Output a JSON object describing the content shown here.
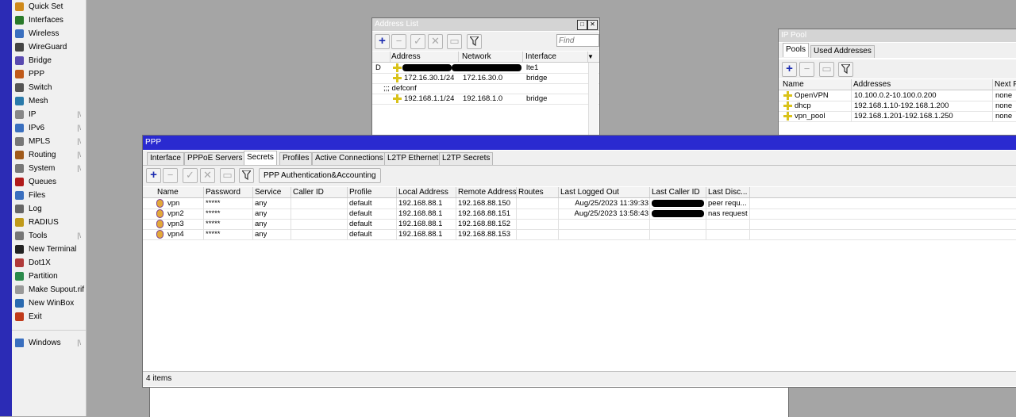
{
  "menu": {
    "items": [
      {
        "label": "Quick Set",
        "icon": "quick-set-icon",
        "arrow": false
      },
      {
        "label": "Interfaces",
        "icon": "interfaces-icon",
        "arrow": false
      },
      {
        "label": "Wireless",
        "icon": "wireless-icon",
        "arrow": false
      },
      {
        "label": "WireGuard",
        "icon": "wireguard-icon",
        "arrow": false
      },
      {
        "label": "Bridge",
        "icon": "bridge-icon",
        "arrow": false
      },
      {
        "label": "PPP",
        "icon": "ppp-icon",
        "arrow": false
      },
      {
        "label": "Switch",
        "icon": "switch-icon",
        "arrow": false
      },
      {
        "label": "Mesh",
        "icon": "mesh-icon",
        "arrow": false
      },
      {
        "label": "IP",
        "icon": "ip-icon",
        "arrow": true
      },
      {
        "label": "IPv6",
        "icon": "ipv6-icon",
        "arrow": true
      },
      {
        "label": "MPLS",
        "icon": "mpls-icon",
        "arrow": true
      },
      {
        "label": "Routing",
        "icon": "routing-icon",
        "arrow": true
      },
      {
        "label": "System",
        "icon": "system-icon",
        "arrow": true
      },
      {
        "label": "Queues",
        "icon": "queues-icon",
        "arrow": false
      },
      {
        "label": "Files",
        "icon": "files-icon",
        "arrow": false
      },
      {
        "label": "Log",
        "icon": "log-icon",
        "arrow": false
      },
      {
        "label": "RADIUS",
        "icon": "radius-icon",
        "arrow": false
      },
      {
        "label": "Tools",
        "icon": "tools-icon",
        "arrow": true
      },
      {
        "label": "New Terminal",
        "icon": "terminal-icon",
        "arrow": false
      },
      {
        "label": "Dot1X",
        "icon": "dot1x-icon",
        "arrow": false
      },
      {
        "label": "Partition",
        "icon": "partition-icon",
        "arrow": false
      },
      {
        "label": "Make Supout.rif",
        "icon": "supout-icon",
        "arrow": false
      },
      {
        "label": "New WinBox",
        "icon": "winbox-icon",
        "arrow": false
      },
      {
        "label": "Exit",
        "icon": "exit-icon",
        "arrow": false
      }
    ],
    "windows_label": "Windows",
    "arrow_glyph": "|\\"
  },
  "address_list": {
    "title": "Address List",
    "find_placeholder": "Find",
    "columns": [
      "Address",
      "Network",
      "Interface"
    ],
    "rows": [
      {
        "flag": "D",
        "address": "",
        "network": "",
        "interface": "lte1",
        "redacted": true
      },
      {
        "flag": "",
        "address": "172.16.30.1/24",
        "network": "172.16.30.0",
        "interface": "bridge",
        "redacted": false
      }
    ],
    "comment": ";;; defconf",
    "rows2": [
      {
        "flag": "",
        "address": "192.168.1.1/24",
        "network": "192.168.1.0",
        "interface": "bridge"
      }
    ]
  },
  "ip_pool": {
    "title": "IP Pool",
    "tabs": [
      "Pools",
      "Used Addresses"
    ],
    "columns": [
      "Name",
      "Addresses",
      "Next P"
    ],
    "rows": [
      {
        "name": "OpenVPN",
        "addresses": "10.100.0.2-10.100.0.200",
        "next": "none"
      },
      {
        "name": "dhcp",
        "addresses": "192.168.1.10-192.168.1.200",
        "next": "none"
      },
      {
        "name": "vpn_pool",
        "addresses": "192.168.1.201-192.168.1.250",
        "next": "none"
      }
    ]
  },
  "ppp": {
    "title": "PPP",
    "tabs": [
      "Interface",
      "PPPoE Servers",
      "Secrets",
      "Profiles",
      "Active Connections",
      "L2TP Ethernet",
      "L2TP Secrets"
    ],
    "auth_button": "PPP Authentication&Accounting",
    "columns": [
      "Name",
      "Password",
      "Service",
      "Caller ID",
      "Profile",
      "Local Address",
      "Remote Address",
      "Routes",
      "Last Logged Out",
      "Last Caller ID",
      "Last Disc..."
    ],
    "rows": [
      {
        "name": "vpn",
        "password": "*****",
        "service": "any",
        "caller_id": "",
        "profile": "default",
        "local": "192.168.88.1",
        "remote": "192.168.88.150",
        "routes": "",
        "logged_out": "Aug/25/2023 11:39:33",
        "last_caller": "",
        "last_disc": "peer requ..."
      },
      {
        "name": "vpn2",
        "password": "*****",
        "service": "any",
        "caller_id": "",
        "profile": "default",
        "local": "192.168.88.1",
        "remote": "192.168.88.151",
        "routes": "",
        "logged_out": "Aug/25/2023 13:58:43",
        "last_caller": "",
        "last_disc": "nas request"
      },
      {
        "name": "vpn3",
        "password": "*****",
        "service": "any",
        "caller_id": "",
        "profile": "default",
        "local": "192.168.88.1",
        "remote": "192.168.88.152",
        "routes": "",
        "logged_out": "",
        "last_caller": "",
        "last_disc": ""
      },
      {
        "name": "vpn4",
        "password": "*****",
        "service": "any",
        "caller_id": "",
        "profile": "default",
        "local": "192.168.88.1",
        "remote": "192.168.88.153",
        "routes": "",
        "logged_out": "",
        "last_caller": "",
        "last_disc": ""
      }
    ],
    "status": "4 items"
  },
  "colors": {
    "accent": "#2a2ad0",
    "side_band": "#2b2bb5",
    "desktop": "#a5a5a5"
  }
}
